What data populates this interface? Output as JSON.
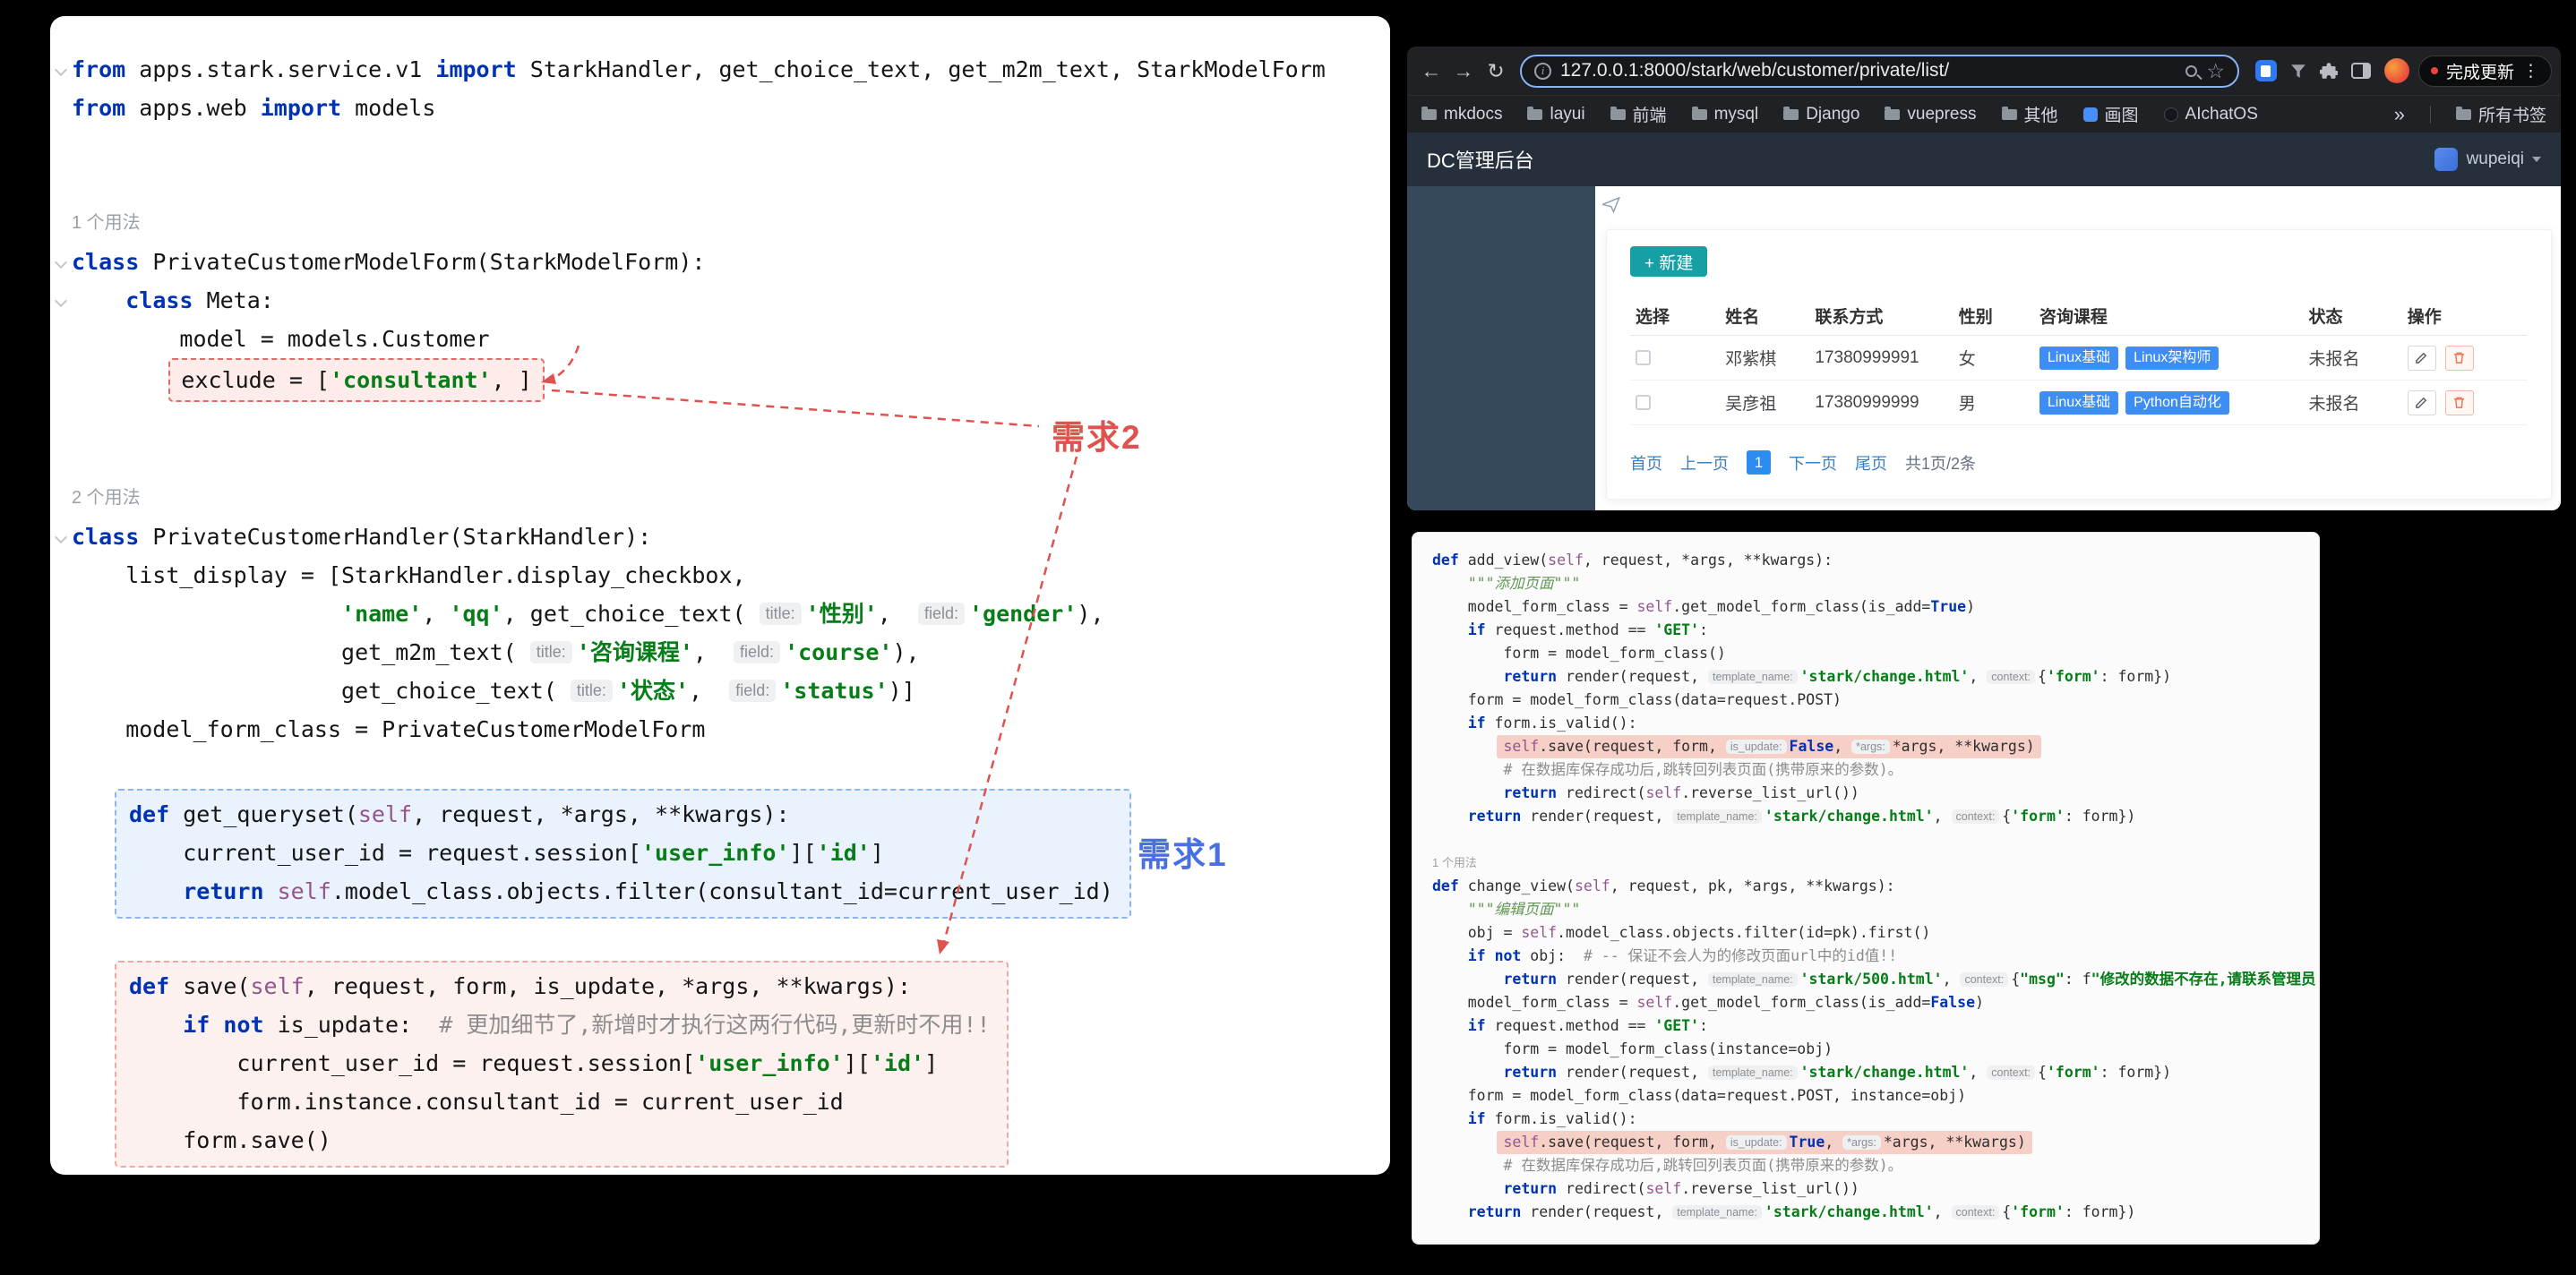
{
  "annotations": {
    "req1": "需求1",
    "req2": "需求2"
  },
  "colors": {
    "accent_teal": "#16a0a6",
    "badge_blue": "#3d8df5",
    "delete_orange": "#ee7752",
    "req1_blue": "#4a6fe3",
    "req2_red": "#e0524d",
    "url_focus_blue": "#87b3f8",
    "pagination_active": "#2d8cf0",
    "highlight_pink": "#f6cfc7"
  },
  "left_editor": {
    "lines": [
      {
        "fold": 1,
        "t": [
          [
            "k",
            "from"
          ],
          [
            "p",
            " apps.stark.service.v1 "
          ],
          [
            "k",
            "import"
          ],
          [
            "p",
            " StarkHandler, get_choice_text, get_m2m_text, StarkModelForm"
          ]
        ]
      },
      {
        "t": [
          [
            "k",
            "from"
          ],
          [
            "p",
            " apps.web "
          ],
          [
            "k",
            "import"
          ],
          [
            "p",
            " models"
          ]
        ]
      },
      {},
      {},
      {
        "label": "1 个用法"
      },
      {
        "fold": 1,
        "t": [
          [
            "k",
            "class"
          ],
          [
            "p",
            " PrivateCustomerModelForm(StarkModelForm):"
          ]
        ]
      },
      {
        "fold": 1,
        "t": [
          [
            "p",
            "    "
          ],
          [
            "k",
            "class"
          ],
          [
            "p",
            " Meta:"
          ]
        ]
      },
      {
        "t": [
          [
            "p",
            "        model = models.Customer"
          ]
        ]
      },
      {
        "pre": "        ",
        "wrap": "excl",
        "t": [
          [
            "p",
            "exclude = ["
          ],
          [
            "s",
            "'consultant'"
          ],
          [
            "p",
            ", ]"
          ]
        ]
      },
      {},
      {},
      {
        "label": "2 个用法"
      },
      {
        "fold": 1,
        "t": [
          [
            "k",
            "class"
          ],
          [
            "p",
            " PrivateCustomerHandler(StarkHandler):"
          ]
        ]
      },
      {
        "t": [
          [
            "p",
            "    list_display = [StarkHandler.display_checkbox,"
          ]
        ]
      },
      {
        "t": [
          [
            "p",
            "                    "
          ],
          [
            "s",
            "'name'"
          ],
          [
            "p",
            ", "
          ],
          [
            "s",
            "'qq'"
          ],
          [
            "p",
            ", get_choice_text( "
          ],
          [
            "h",
            "title:"
          ],
          [
            "s",
            "'性别'"
          ],
          [
            "p",
            ",  "
          ],
          [
            "h",
            "field:"
          ],
          [
            "s",
            "'gender'"
          ],
          [
            "p",
            "),"
          ]
        ]
      },
      {
        "t": [
          [
            "p",
            "                    get_m2m_text( "
          ],
          [
            "h",
            "title:"
          ],
          [
            "s",
            "'咨询课程'"
          ],
          [
            "p",
            ",  "
          ],
          [
            "h",
            "field:"
          ],
          [
            "s",
            "'course'"
          ],
          [
            "p",
            "),"
          ]
        ]
      },
      {
        "t": [
          [
            "p",
            "                    get_choice_text( "
          ],
          [
            "h",
            "title:"
          ],
          [
            "s",
            "'状态'"
          ],
          [
            "p",
            ",  "
          ],
          [
            "h",
            "field:"
          ],
          [
            "s",
            "'status'"
          ],
          [
            "p",
            ")]"
          ]
        ]
      },
      {
        "t": [
          [
            "p",
            "    model_form_class = PrivateCustomerModelForm"
          ]
        ]
      },
      {},
      {
        "box": "blue",
        "t": [
          [
            "k",
            "def"
          ],
          [
            "p",
            " get_queryset("
          ],
          [
            "f",
            "self"
          ],
          [
            "p",
            ", request, *args, **kwargs):"
          ]
        ]
      },
      {
        "box": "blue",
        "t": [
          [
            "p",
            "    current_user_id = request.session["
          ],
          [
            "s",
            "'user_info'"
          ],
          [
            "p",
            "]["
          ],
          [
            "s",
            "'id'"
          ],
          [
            "p",
            "]"
          ]
        ]
      },
      {
        "box": "blue",
        "t": [
          [
            "p",
            "    "
          ],
          [
            "k",
            "return"
          ],
          [
            "p",
            " "
          ],
          [
            "f",
            "self"
          ],
          [
            "p",
            ".model_class.objects.filter(consultant_id=current_user_id)"
          ]
        ]
      },
      {},
      {
        "box": "pink",
        "t": [
          [
            "k",
            "def"
          ],
          [
            "p",
            " save("
          ],
          [
            "f",
            "self"
          ],
          [
            "p",
            ", request, form, is_update, *args, **kwargs):"
          ]
        ]
      },
      {
        "box": "pink",
        "t": [
          [
            "p",
            "    "
          ],
          [
            "k",
            "if"
          ],
          [
            "p",
            " "
          ],
          [
            "k",
            "not"
          ],
          [
            "p",
            " is_update:  "
          ],
          [
            "c",
            "# 更加细节了,新增时才执行这两行代码,更新时不用!!"
          ]
        ]
      },
      {
        "box": "pink",
        "t": [
          [
            "p",
            "        current_user_id = request.session["
          ],
          [
            "s",
            "'user_info'"
          ],
          [
            "p",
            "]["
          ],
          [
            "s",
            "'id'"
          ],
          [
            "p",
            "]"
          ]
        ]
      },
      {
        "box": "pink",
        "t": [
          [
            "p",
            "        form.instance.consultant_id = current_user_id"
          ]
        ]
      },
      {
        "box": "pink",
        "t": [
          [
            "p",
            "    form.save()"
          ]
        ]
      }
    ]
  },
  "snippet": {
    "lines": [
      {
        "t": [
          [
            "k",
            "def"
          ],
          [
            "p",
            " add_view("
          ],
          [
            "f",
            "self"
          ],
          [
            "p",
            ", request, *args, **kwargs):"
          ]
        ]
      },
      {
        "t": [
          [
            "p",
            "    "
          ],
          [
            "d",
            "\"\"\"添加页面\"\"\""
          ]
        ]
      },
      {
        "t": [
          [
            "p",
            "    model_form_class = "
          ],
          [
            "f",
            "self"
          ],
          [
            "p",
            ".get_model_form_class(is_add="
          ],
          [
            "k",
            "True"
          ],
          [
            "p",
            ")"
          ]
        ]
      },
      {
        "t": [
          [
            "p",
            "    "
          ],
          [
            "k",
            "if"
          ],
          [
            "p",
            " request.method == "
          ],
          [
            "s",
            "'GET'"
          ],
          [
            "p",
            ":"
          ]
        ]
      },
      {
        "t": [
          [
            "p",
            "        form = model_form_class()"
          ]
        ]
      },
      {
        "t": [
          [
            "p",
            "        "
          ],
          [
            "k",
            "return"
          ],
          [
            "p",
            " render(request, "
          ],
          [
            "h",
            "template_name:"
          ],
          [
            "s",
            "'stark/change.html'"
          ],
          [
            "p",
            ", "
          ],
          [
            "h",
            "context:"
          ],
          [
            "p",
            "{"
          ],
          [
            "s",
            "'form'"
          ],
          [
            "p",
            ": form})"
          ]
        ]
      },
      {
        "t": [
          [
            "p",
            "    form = model_form_class(data=request.POST)"
          ]
        ]
      },
      {
        "t": [
          [
            "p",
            "    "
          ],
          [
            "k",
            "if"
          ],
          [
            "p",
            " form.is_valid():"
          ]
        ]
      },
      {
        "pre": "        ",
        "wrap": "hlp",
        "t": [
          [
            "f",
            "self"
          ],
          [
            "p",
            ".save(request, form, "
          ],
          [
            "h",
            "is_update:"
          ],
          [
            "k",
            "False"
          ],
          [
            "p",
            ", "
          ],
          [
            "h",
            "*args:"
          ],
          [
            "p",
            "*args, **kwargs)"
          ]
        ]
      },
      {
        "t": [
          [
            "p",
            "        "
          ],
          [
            "c",
            "# 在数据库保存成功后,跳转回列表页面(携带原来的参数)。"
          ]
        ]
      },
      {
        "t": [
          [
            "p",
            "        "
          ],
          [
            "k",
            "return"
          ],
          [
            "p",
            " redirect("
          ],
          [
            "f",
            "self"
          ],
          [
            "p",
            ".reverse_list_url())"
          ]
        ]
      },
      {
        "t": [
          [
            "p",
            "    "
          ],
          [
            "k",
            "return"
          ],
          [
            "p",
            " render(request, "
          ],
          [
            "h",
            "template_name:"
          ],
          [
            "s",
            "'stark/change.html'"
          ],
          [
            "p",
            ", "
          ],
          [
            "h",
            "context:"
          ],
          [
            "p",
            "{"
          ],
          [
            "s",
            "'form'"
          ],
          [
            "p",
            ": form})"
          ]
        ]
      },
      {},
      {
        "label": "1 个用法"
      },
      {
        "t": [
          [
            "k",
            "def"
          ],
          [
            "p",
            " change_view("
          ],
          [
            "f",
            "self"
          ],
          [
            "p",
            ", request, pk, *args, **kwargs):"
          ]
        ]
      },
      {
        "t": [
          [
            "p",
            "    "
          ],
          [
            "d",
            "\"\"\"编辑页面\"\"\""
          ]
        ]
      },
      {
        "t": [
          [
            "p",
            "    obj = "
          ],
          [
            "f",
            "self"
          ],
          [
            "p",
            ".model_class.objects.filter(id=pk).first()"
          ]
        ]
      },
      {
        "t": [
          [
            "p",
            "    "
          ],
          [
            "k",
            "if"
          ],
          [
            "p",
            " "
          ],
          [
            "k",
            "not"
          ],
          [
            "p",
            " obj:  "
          ],
          [
            "c",
            "# -- 保证不会人为的修改页面url中的id值!!"
          ]
        ]
      },
      {
        "t": [
          [
            "p",
            "        "
          ],
          [
            "k",
            "return"
          ],
          [
            "p",
            " render(request, "
          ],
          [
            "h",
            "template_name:"
          ],
          [
            "s",
            "'stark/500.html'"
          ],
          [
            "p",
            ", "
          ],
          [
            "h",
            "context:"
          ],
          [
            "p",
            "{"
          ],
          [
            "s",
            "\"msg\""
          ],
          [
            "p",
            ": f"
          ],
          [
            "s",
            "\"修改的数据不存在,请联系管理员!\""
          ],
          [
            "p",
            "})"
          ]
        ]
      },
      {
        "t": [
          [
            "p",
            "    model_form_class = "
          ],
          [
            "f",
            "self"
          ],
          [
            "p",
            ".get_model_form_class(is_add="
          ],
          [
            "k",
            "False"
          ],
          [
            "p",
            ")"
          ]
        ]
      },
      {
        "t": [
          [
            "p",
            "    "
          ],
          [
            "k",
            "if"
          ],
          [
            "p",
            " request.method == "
          ],
          [
            "s",
            "'GET'"
          ],
          [
            "p",
            ":"
          ]
        ]
      },
      {
        "t": [
          [
            "p",
            "        form = model_form_class(instance=obj)"
          ]
        ]
      },
      {
        "t": [
          [
            "p",
            "        "
          ],
          [
            "k",
            "return"
          ],
          [
            "p",
            " render(request, "
          ],
          [
            "h",
            "template_name:"
          ],
          [
            "s",
            "'stark/change.html'"
          ],
          [
            "p",
            ", "
          ],
          [
            "h",
            "context:"
          ],
          [
            "p",
            "{"
          ],
          [
            "s",
            "'form'"
          ],
          [
            "p",
            ": form})"
          ]
        ]
      },
      {
        "t": [
          [
            "p",
            "    form = model_form_class(data=request.POST, instance=obj)"
          ]
        ]
      },
      {
        "t": [
          [
            "p",
            "    "
          ],
          [
            "k",
            "if"
          ],
          [
            "p",
            " form.is_valid():"
          ]
        ]
      },
      {
        "pre": "        ",
        "wrap": "hlp",
        "t": [
          [
            "f",
            "self"
          ],
          [
            "p",
            ".save(request, form, "
          ],
          [
            "h",
            "is_update:"
          ],
          [
            "k",
            "True"
          ],
          [
            "p",
            ", "
          ],
          [
            "h",
            "*args:"
          ],
          [
            "p",
            "*args, **kwargs)"
          ]
        ]
      },
      {
        "t": [
          [
            "p",
            "        "
          ],
          [
            "c",
            "# 在数据库保存成功后,跳转回列表页面(携带原来的参数)。"
          ]
        ]
      },
      {
        "t": [
          [
            "p",
            "        "
          ],
          [
            "k",
            "return"
          ],
          [
            "p",
            " redirect("
          ],
          [
            "f",
            "self"
          ],
          [
            "p",
            ".reverse_list_url())"
          ]
        ]
      },
      {
        "t": [
          [
            "p",
            "    "
          ],
          [
            "k",
            "return"
          ],
          [
            "p",
            " render(request, "
          ],
          [
            "h",
            "template_name:"
          ],
          [
            "s",
            "'stark/change.html'"
          ],
          [
            "p",
            ", "
          ],
          [
            "h",
            "context:"
          ],
          [
            "p",
            "{"
          ],
          [
            "s",
            "'form'"
          ],
          [
            "p",
            ": form})"
          ]
        ]
      }
    ]
  },
  "browser": {
    "toolbar": {
      "url": "127.0.0.1:8000/stark/web/customer/private/list/",
      "update_button": "完成更新"
    },
    "bookmarks": {
      "items": [
        {
          "label": "mkdocs",
          "icon": "folder"
        },
        {
          "label": "layui",
          "icon": "folder"
        },
        {
          "label": "前端",
          "icon": "folder"
        },
        {
          "label": "mysql",
          "icon": "folder"
        },
        {
          "label": "Django",
          "icon": "folder"
        },
        {
          "label": "vuepress",
          "icon": "folder"
        },
        {
          "label": "其他",
          "icon": "folder"
        },
        {
          "label": "画图",
          "icon": "app-blue"
        },
        {
          "label": "AIchatOS",
          "icon": "app-dark"
        }
      ],
      "overflow": "»",
      "all_label": "所有书签"
    },
    "site": {
      "brand": "DC管理后台",
      "user": "wupeiqi",
      "new_button": "+ 新建",
      "table": {
        "headers": [
          "选择",
          "姓名",
          "联系方式",
          "性别",
          "咨询课程",
          "状态",
          "操作"
        ],
        "rows": [
          {
            "name": "邓紫棋",
            "phone": "17380999991",
            "gender": "女",
            "courses": [
              "Linux基础",
              "Linux架构师"
            ],
            "status": "未报名"
          },
          {
            "name": "吴彦祖",
            "phone": "17380999999",
            "gender": "男",
            "courses": [
              "Linux基础",
              "Python自动化"
            ],
            "status": "未报名"
          }
        ]
      },
      "pagination": {
        "first": "首页",
        "prev": "上一页",
        "page": "1",
        "next": "下一页",
        "last": "尾页",
        "summary": "共1页/2条"
      }
    }
  }
}
